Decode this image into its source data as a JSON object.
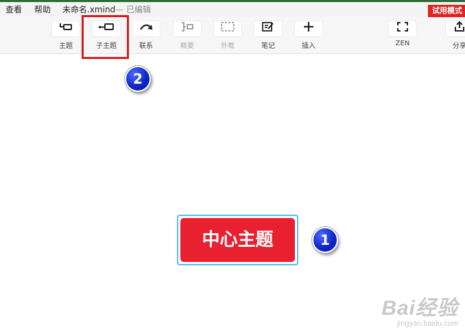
{
  "menubar": {
    "view": "查看",
    "help": "帮助",
    "filename": "未命名.xmind",
    "separator": "—",
    "status": "已编辑",
    "trial_badge": "试用模式"
  },
  "toolbar": {
    "topic": "主题",
    "subtopic": "子主题",
    "relationship": "联系",
    "summary": "概要",
    "boundary": "外框",
    "note": "笔记",
    "insert": "插入",
    "zen": "ZEN",
    "share": "分享"
  },
  "canvas": {
    "central_topic": "中心主题",
    "central_topic_color": "#e8202f",
    "selection_color": "#4fc0ee"
  },
  "annotations": {
    "marker_1": "1",
    "marker_2": "2",
    "highlight_color": "#d91b1b"
  },
  "watermark": {
    "logo": "Bai经验",
    "url": "jingyan.baidu.com"
  }
}
